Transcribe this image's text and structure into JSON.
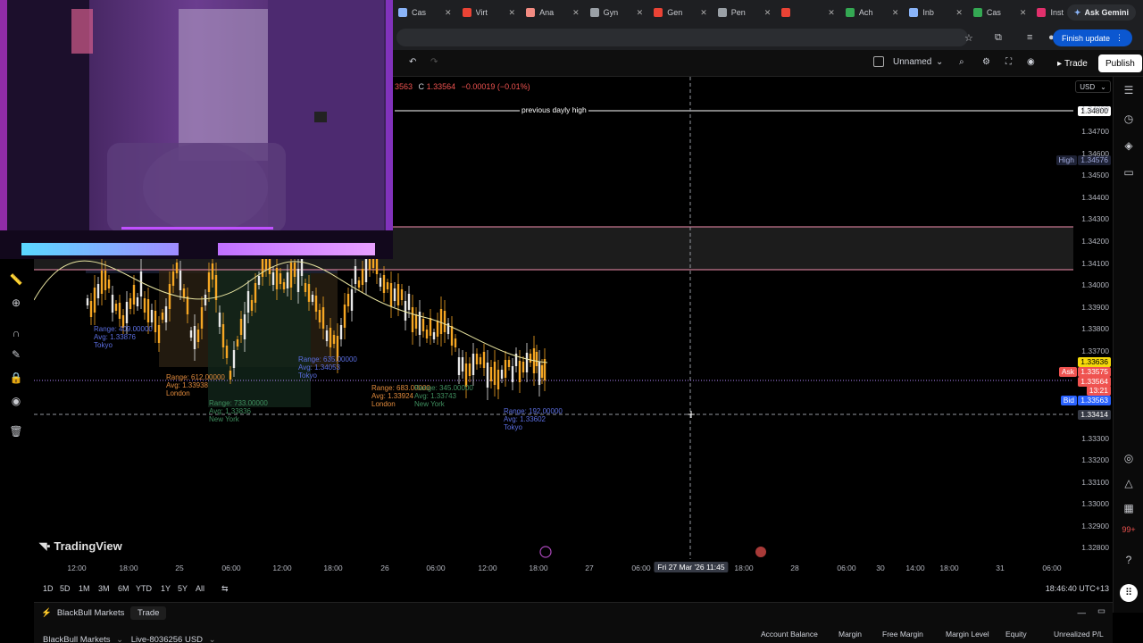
{
  "browser": {
    "tabs": [
      {
        "label": "Cas",
        "color": "#8ab4f8"
      },
      {
        "label": "Virt",
        "color": "#ea4335"
      },
      {
        "label": "Ana",
        "color": "#f28b82"
      },
      {
        "label": "Gyn",
        "color": "#9aa0a6"
      },
      {
        "label": "Gen",
        "color": "#ea4335"
      },
      {
        "label": "Pen",
        "color": "#9aa0a6"
      },
      {
        "label": "",
        "color": "#ea4335"
      },
      {
        "label": "Ach",
        "color": "#34a853"
      },
      {
        "label": "Inb",
        "color": "#8ab4f8"
      },
      {
        "label": "Cas",
        "color": "#34a853"
      },
      {
        "label": "Inst",
        "color": "#e1306c"
      }
    ],
    "ask_gemini": "Ask Gemini",
    "finish_update": "Finish update"
  },
  "toolbar": {
    "layout_name": "Unnamed",
    "trade_label": "Trade",
    "publish_label": "Publish"
  },
  "ohlc": {
    "prefix": "3563",
    "close_label": "C",
    "close": "1.33564",
    "change": "−0.00019 (−0.01%)"
  },
  "price_scale": {
    "currency": "USD",
    "labels": [
      "1.34800",
      "1.34700",
      "1.34600",
      "1.34500",
      "1.34400",
      "1.34300",
      "1.34200",
      "1.34100",
      "1.34000",
      "1.33900",
      "1.33800",
      "1.33700",
      "1.33300",
      "1.33200",
      "1.33100",
      "1.33000",
      "1.32900",
      "1.32800"
    ],
    "high_label": "High",
    "high_value": "1.34576",
    "pdh_value": "1.34800",
    "tag_yellow": "1.33636",
    "ask_label": "Ask",
    "ask_value": "1.33575",
    "last_value": "1.33564",
    "countdown": "13:21",
    "bid_label": "Bid",
    "bid_value": "1.33563",
    "cross_value": "1.33414"
  },
  "annotations": {
    "pdh": "previous dayly high",
    "sessions": [
      {
        "range": "Range: 409.00000",
        "avg": "Avg: 1.33876",
        "name": "Tokyo",
        "color": "#5b6ee1"
      },
      {
        "range": "Range: 612.00000",
        "avg": "Avg: 1.33938",
        "name": "London",
        "color": "#e08a3c"
      },
      {
        "range": "Range: 733.00000",
        "avg": "Avg: 1.33836",
        "name": "New York",
        "color": "#3f8f5f"
      },
      {
        "range": "Range: 635.00000",
        "avg": "Avg: 1.34053",
        "name": "Tokyo",
        "color": "#5b6ee1"
      },
      {
        "range": "Range: 683.00000",
        "avg": "Avg: 1.33924",
        "name": "London",
        "color": "#e08a3c"
      },
      {
        "range": "Range: 345.00000",
        "avg": "Avg: 1.33743",
        "name": "New York",
        "color": "#3f8f5f"
      },
      {
        "range": "Range: 192.00000",
        "avg": "Avg: 1.33602",
        "name": "Tokyo",
        "color": "#5b6ee1"
      }
    ]
  },
  "time_axis": {
    "labels": [
      "12:00",
      "18:00",
      "25",
      "06:00",
      "12:00",
      "18:00",
      "26",
      "06:00",
      "12:00",
      "18:00",
      "27",
      "06:00",
      "18:00",
      "28",
      "06:00",
      "30",
      "14:00",
      "18:00",
      "31",
      "06:00"
    ],
    "crosshair": "Fri 27 Mar '26   11:45"
  },
  "timeframes": [
    "1D",
    "5D",
    "1M",
    "3M",
    "6M",
    "YTD",
    "1Y",
    "5Y",
    "All"
  ],
  "clock": "18:46:40 UTC+13",
  "branding": "TradingView",
  "bottom": {
    "broker": "BlackBull Markets",
    "trade": "Trade",
    "account_broker": "BlackBull Markets",
    "account_id": "Live-8036256 USD",
    "metrics": [
      "Account Balance",
      "Margin",
      "Free Margin",
      "Margin Level",
      "Equity",
      "Unrealized P/L"
    ]
  },
  "colors": {
    "up": "#26a69a",
    "down": "#ef5350",
    "candle_orange": "#f5a623",
    "candle_white": "#e8e8e8",
    "zone_fill": "#1c1c1c",
    "zone_border": "#f48fb1",
    "ma": "#e8e4a0",
    "accent": "#2962ff"
  }
}
